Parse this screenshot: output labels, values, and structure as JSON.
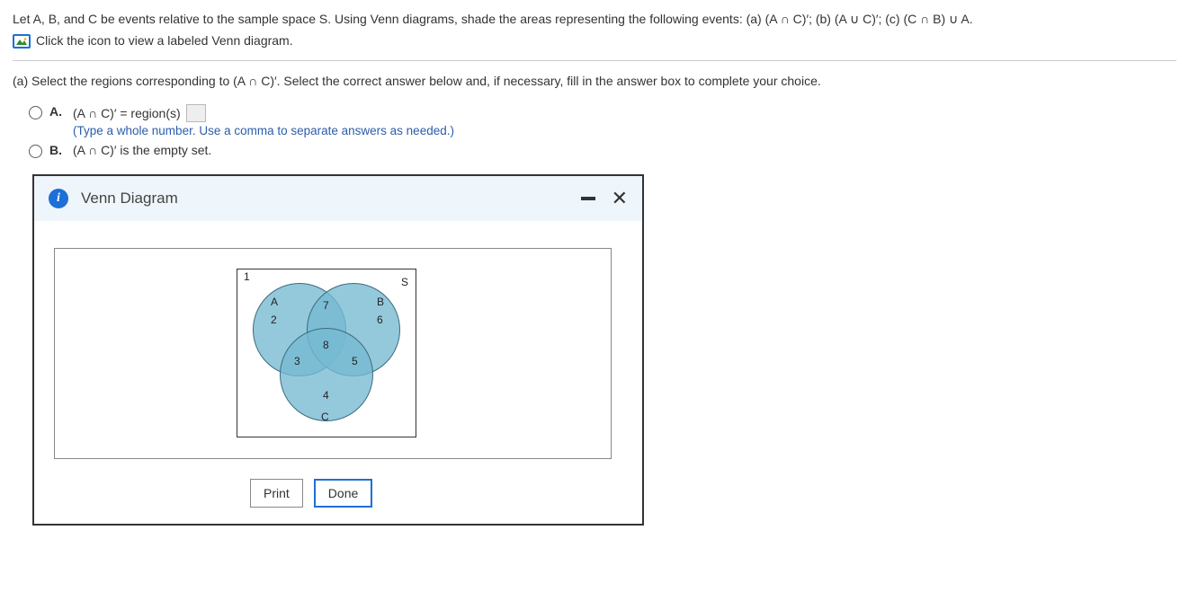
{
  "question": {
    "statement": "Let A, B, and C be events relative to the sample space S. Using Venn diagrams, shade the areas representing the following events: (a) (A ∩ C)′; (b) (A ∪ C)′; (c) (C ∩ B) ∪ A.",
    "click_hint": "Click the icon to view a labeled Venn diagram."
  },
  "part_a": {
    "prompt": "(a) Select the regions corresponding to (A ∩ C)′. Select the correct answer below and, if necessary, fill in the answer box to complete your choice.",
    "choice_A": {
      "letter": "A.",
      "text": "(A ∩ C)′ = region(s)",
      "hint": "(Type a whole number. Use a comma to separate answers as needed.)"
    },
    "choice_B": {
      "letter": "B.",
      "text": "(A ∩ C)′ is the empty set."
    }
  },
  "dialog": {
    "title": "Venn Diagram",
    "info_letter": "i",
    "print": "Print",
    "done": "Done"
  },
  "venn": {
    "S": "S",
    "A": "A",
    "B": "B",
    "C": "C",
    "r1": "1",
    "r2": "2",
    "r3": "3",
    "r4": "4",
    "r5": "5",
    "r6": "6",
    "r7": "7",
    "r8": "8"
  }
}
